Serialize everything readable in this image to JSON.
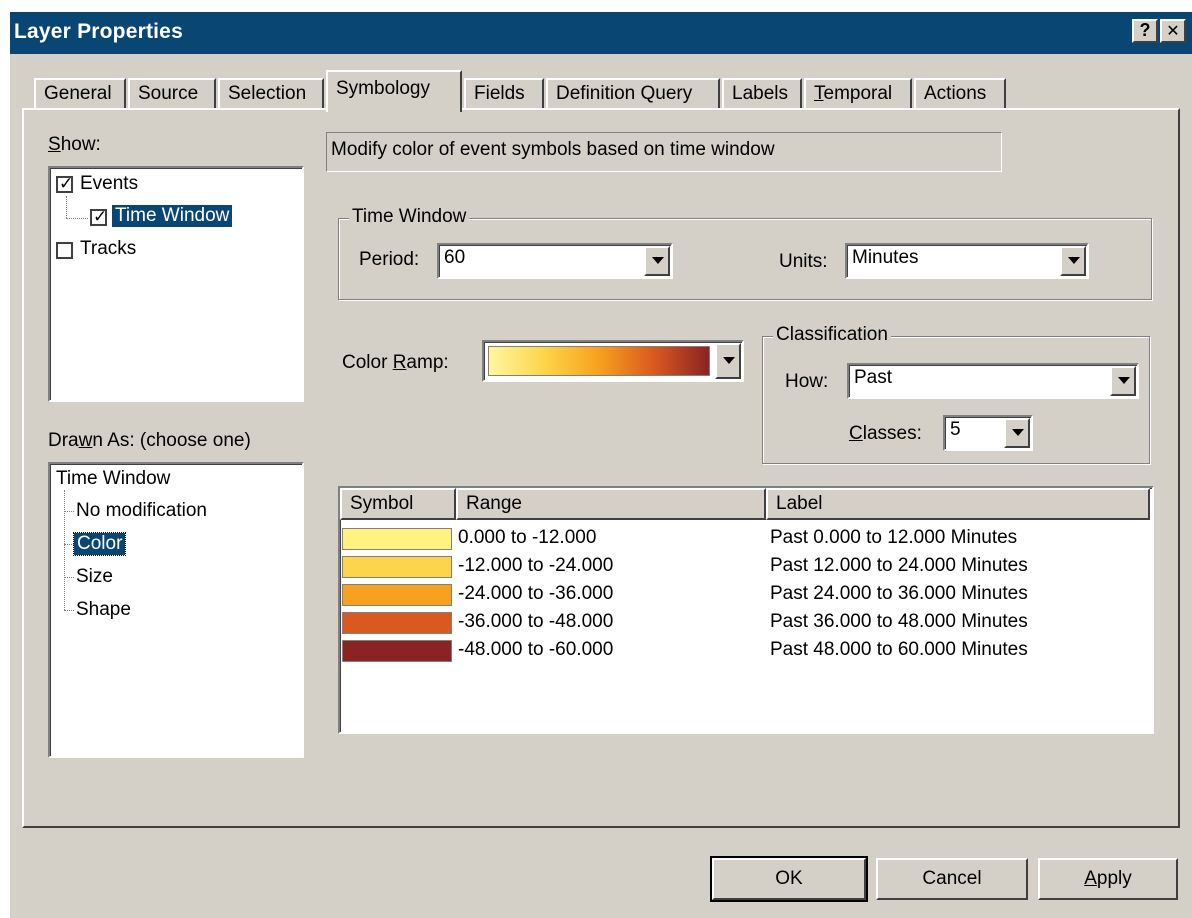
{
  "window": {
    "title": "Layer Properties",
    "help_glyph": "?",
    "close_glyph": "✕"
  },
  "tabs": [
    {
      "label": "General",
      "active": false
    },
    {
      "label": "Source",
      "active": false
    },
    {
      "label": "Selection",
      "active": false
    },
    {
      "label": "Symbology",
      "active": true
    },
    {
      "label": "Fields",
      "active": false
    },
    {
      "label": "Definition Query",
      "active": false
    },
    {
      "label": "Labels",
      "active": false
    },
    {
      "label": "Temporal",
      "active": false
    },
    {
      "label": "Actions",
      "active": false
    }
  ],
  "show": {
    "label_prefix": "S",
    "label_rest": "how:",
    "items": [
      {
        "label": "Events",
        "checked": true
      },
      {
        "label": "Time Window",
        "checked": true
      },
      {
        "label": "Tracks",
        "checked": false
      }
    ]
  },
  "drawn_as": {
    "label_before": "Dra",
    "label_accel": "w",
    "label_after": "n As: (choose one)",
    "root": "Time Window",
    "items": [
      "No modification",
      "Color",
      "Size",
      "Shape"
    ],
    "selected": "Color"
  },
  "description": "Modify color of event symbols based on time window",
  "time_window": {
    "title": "Time Window",
    "period_label": "Period:",
    "period_value": "60",
    "units_label": "Units:",
    "units_value": "Minutes"
  },
  "color_ramp": {
    "label_before": "Color ",
    "label_accel": "R",
    "label_after": "amp:",
    "colors": [
      "#fff6a0",
      "#fdd54a",
      "#f7a11e",
      "#d9591f",
      "#8b2323"
    ]
  },
  "classification": {
    "title": "Classification",
    "how_label": "How:",
    "how_value": "Past",
    "classes_accel": "C",
    "classes_rest": "lasses:",
    "classes_value": "5"
  },
  "table": {
    "headers": [
      "Symbol",
      "Range",
      "Label"
    ],
    "rows": [
      {
        "color": "#fff380",
        "range": "0.000 to -12.000",
        "label": "Past 0.000 to 12.000 Minutes"
      },
      {
        "color": "#fdd54a",
        "range": "-12.000 to -24.000",
        "label": "Past 12.000 to 24.000 Minutes"
      },
      {
        "color": "#f7a11e",
        "range": "-24.000 to -36.000",
        "label": "Past 24.000 to 36.000 Minutes"
      },
      {
        "color": "#d9591f",
        "range": "-36.000 to -48.000",
        "label": "Past 36.000 to 48.000 Minutes"
      },
      {
        "color": "#8b2323",
        "range": "-48.000 to -60.000",
        "label": "Past 48.000 to 60.000 Minutes"
      }
    ]
  },
  "buttons": {
    "ok": "OK",
    "cancel": "Cancel",
    "apply_accel": "A",
    "apply_rest": "pply"
  }
}
